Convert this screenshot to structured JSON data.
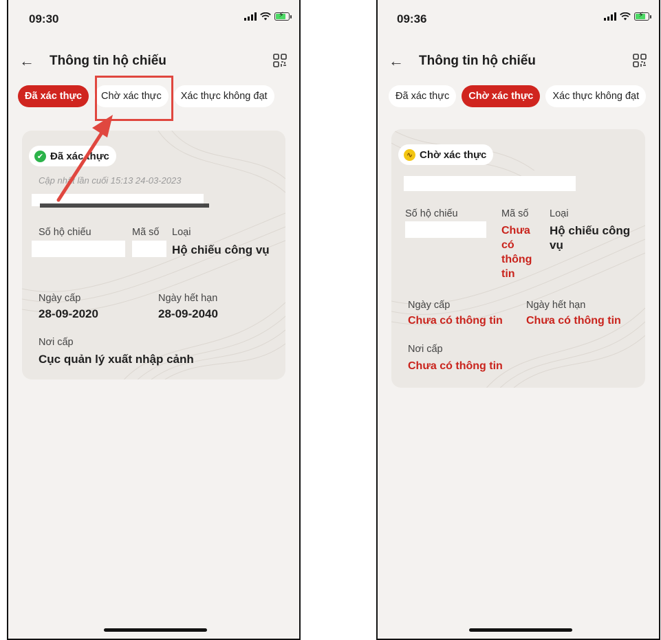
{
  "screens": [
    {
      "status": {
        "time": "09:30"
      },
      "header": {
        "title": "Thông tin hộ chiếu"
      },
      "tabs": [
        "Đã xác thực",
        "Chờ xác thực",
        "Xác thực không đạt"
      ],
      "active_tab": 0,
      "card": {
        "badge": "Đã xác thực",
        "updated": "Cập nhật lần cuối 15:13 24-03-2023",
        "labels": {
          "passport_no": "Số hộ chiếu",
          "code": "Mã số",
          "type": "Loại",
          "issue_date": "Ngày cấp",
          "expiry_date": "Ngày hết hạn",
          "issue_place": "Nơi cấp"
        },
        "values": {
          "type": "Hộ chiếu công vụ",
          "issue_date": "28-09-2020",
          "expiry_date": "28-09-2040",
          "issue_place": "Cục quản lý xuất nhập cảnh"
        }
      }
    },
    {
      "status": {
        "time": "09:36"
      },
      "header": {
        "title": "Thông tin hộ chiếu"
      },
      "tabs": [
        "Đã xác thực",
        "Chờ xác thực",
        "Xác thực không đạt"
      ],
      "active_tab": 1,
      "card": {
        "badge": "Chờ xác thực",
        "labels": {
          "passport_no": "Số hộ chiếu",
          "code": "Mã số",
          "type": "Loại",
          "issue_date": "Ngày cấp",
          "expiry_date": "Ngày hết hạn",
          "issue_place": "Nơi cấp"
        },
        "values": {
          "code": "Chưa có thông tin",
          "type": "Hộ chiếu công vụ",
          "issue_date": "Chưa có thông tin",
          "expiry_date": "Chưa có thông tin",
          "issue_place": "Chưa có thông tin"
        }
      }
    }
  ],
  "colors": {
    "accent": "#d0251f",
    "verified": "#2cb34a",
    "pending": "#f3c613",
    "annotation": "#e0473f"
  },
  "icons": [
    "back-arrow-icon",
    "qr-code-icon",
    "check-circle-icon",
    "pending-wave-icon",
    "signal-icon",
    "wifi-icon",
    "battery-icon"
  ]
}
